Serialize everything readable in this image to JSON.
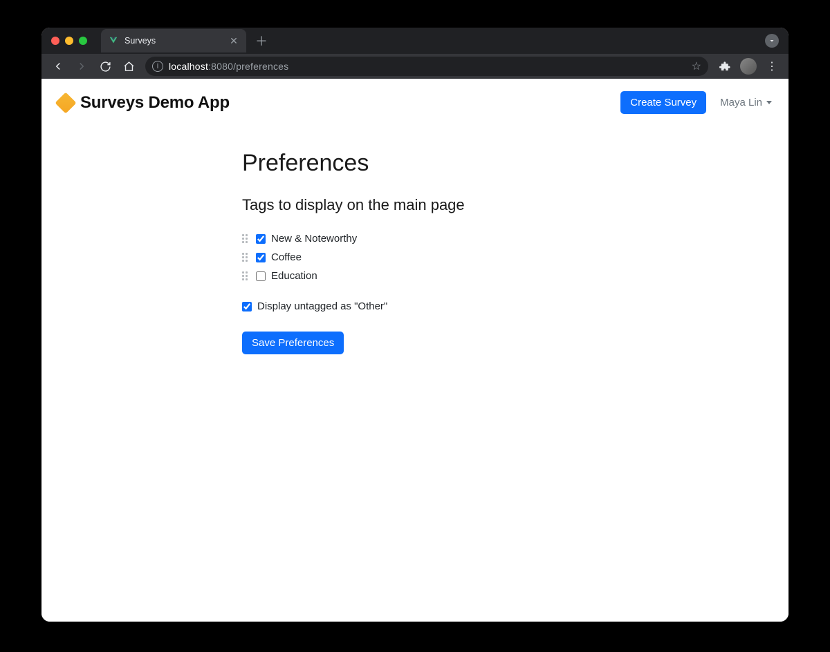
{
  "browser": {
    "tab_title": "Surveys",
    "url_host": "localhost",
    "url_port": ":8080",
    "url_path": "/preferences"
  },
  "nav": {
    "brand_title": "Surveys Demo App",
    "create_button": "Create Survey",
    "user_name": "Maya Lin"
  },
  "page": {
    "heading": "Preferences",
    "subheading": "Tags to display on the main page",
    "tags": [
      {
        "label": "New & Noteworthy",
        "checked": true
      },
      {
        "label": "Coffee",
        "checked": true
      },
      {
        "label": "Education",
        "checked": false
      }
    ],
    "display_untagged_label": "Display untagged as \"Other\"",
    "display_untagged_checked": true,
    "save_button": "Save Preferences"
  }
}
